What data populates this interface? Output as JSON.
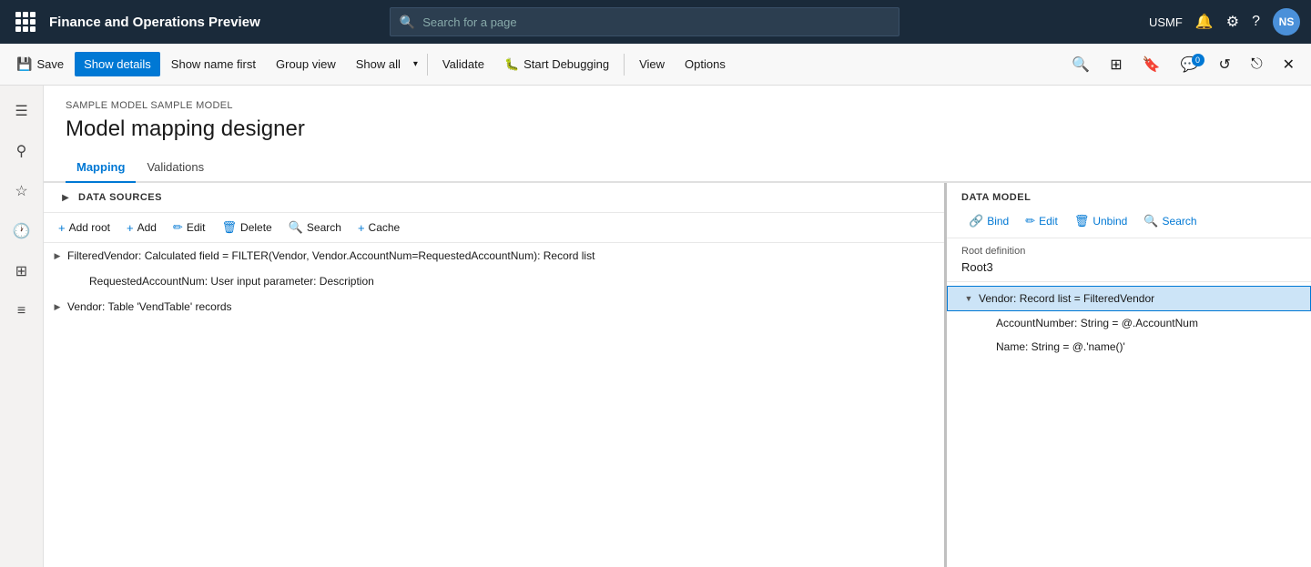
{
  "app": {
    "title": "Finance and Operations Preview",
    "search_placeholder": "Search for a page",
    "region": "USMF"
  },
  "toolbar": {
    "save_label": "Save",
    "show_details_label": "Show details",
    "show_name_first_label": "Show name first",
    "group_view_label": "Group view",
    "show_all_label": "Show all",
    "show_all_arrow": "▾",
    "validate_label": "Validate",
    "start_debugging_label": "Start Debugging",
    "view_label": "View",
    "options_label": "Options"
  },
  "breadcrumb": "SAMPLE MODEL SAMPLE MODEL",
  "page_title": "Model mapping designer",
  "tabs": [
    {
      "label": "Mapping",
      "active": true
    },
    {
      "label": "Validations",
      "active": false
    }
  ],
  "left_panel": {
    "title": "DATA SOURCES",
    "buttons": [
      {
        "label": "Add root",
        "icon": "+"
      },
      {
        "label": "Add",
        "icon": "+"
      },
      {
        "label": "Edit",
        "icon": "✏"
      },
      {
        "label": "Delete",
        "icon": "🗑"
      },
      {
        "label": "Search",
        "icon": "🔍"
      },
      {
        "label": "Cache",
        "icon": "+"
      }
    ],
    "tree": [
      {
        "id": "filtered-vendor",
        "text": "FilteredVendor: Calculated field = FILTER(Vendor, Vendor.AccountNum=RequestedAccountNum): Record list",
        "expanded": false,
        "selected": false,
        "indent": 0,
        "has_expand": true
      },
      {
        "id": "requested-account",
        "text": "RequestedAccountNum: User input parameter: Description",
        "expanded": false,
        "selected": false,
        "indent": 1,
        "has_expand": false
      },
      {
        "id": "vendor-table",
        "text": "Vendor: Table 'VendTable' records",
        "expanded": false,
        "selected": false,
        "indent": 0,
        "has_expand": true
      }
    ]
  },
  "right_panel": {
    "title": "DATA MODEL",
    "buttons": [
      {
        "label": "Bind",
        "icon": "🔗"
      },
      {
        "label": "Edit",
        "icon": "✏"
      },
      {
        "label": "Unbind",
        "icon": "🗑"
      },
      {
        "label": "Search",
        "icon": "🔍"
      }
    ],
    "root_definition_label": "Root definition",
    "root_value": "Root3",
    "tree": [
      {
        "id": "vendor-record",
        "text": "Vendor: Record list = FilteredVendor",
        "expanded": true,
        "selected": true,
        "indent": 0,
        "has_expand": true,
        "expand_char": "▼"
      },
      {
        "id": "account-number",
        "text": "AccountNumber: String = @.AccountNum",
        "expanded": false,
        "selected": false,
        "indent": 1,
        "has_expand": false
      },
      {
        "id": "name",
        "text": "Name: String = @.'name()'",
        "expanded": false,
        "selected": false,
        "indent": 1,
        "has_expand": false
      }
    ]
  }
}
